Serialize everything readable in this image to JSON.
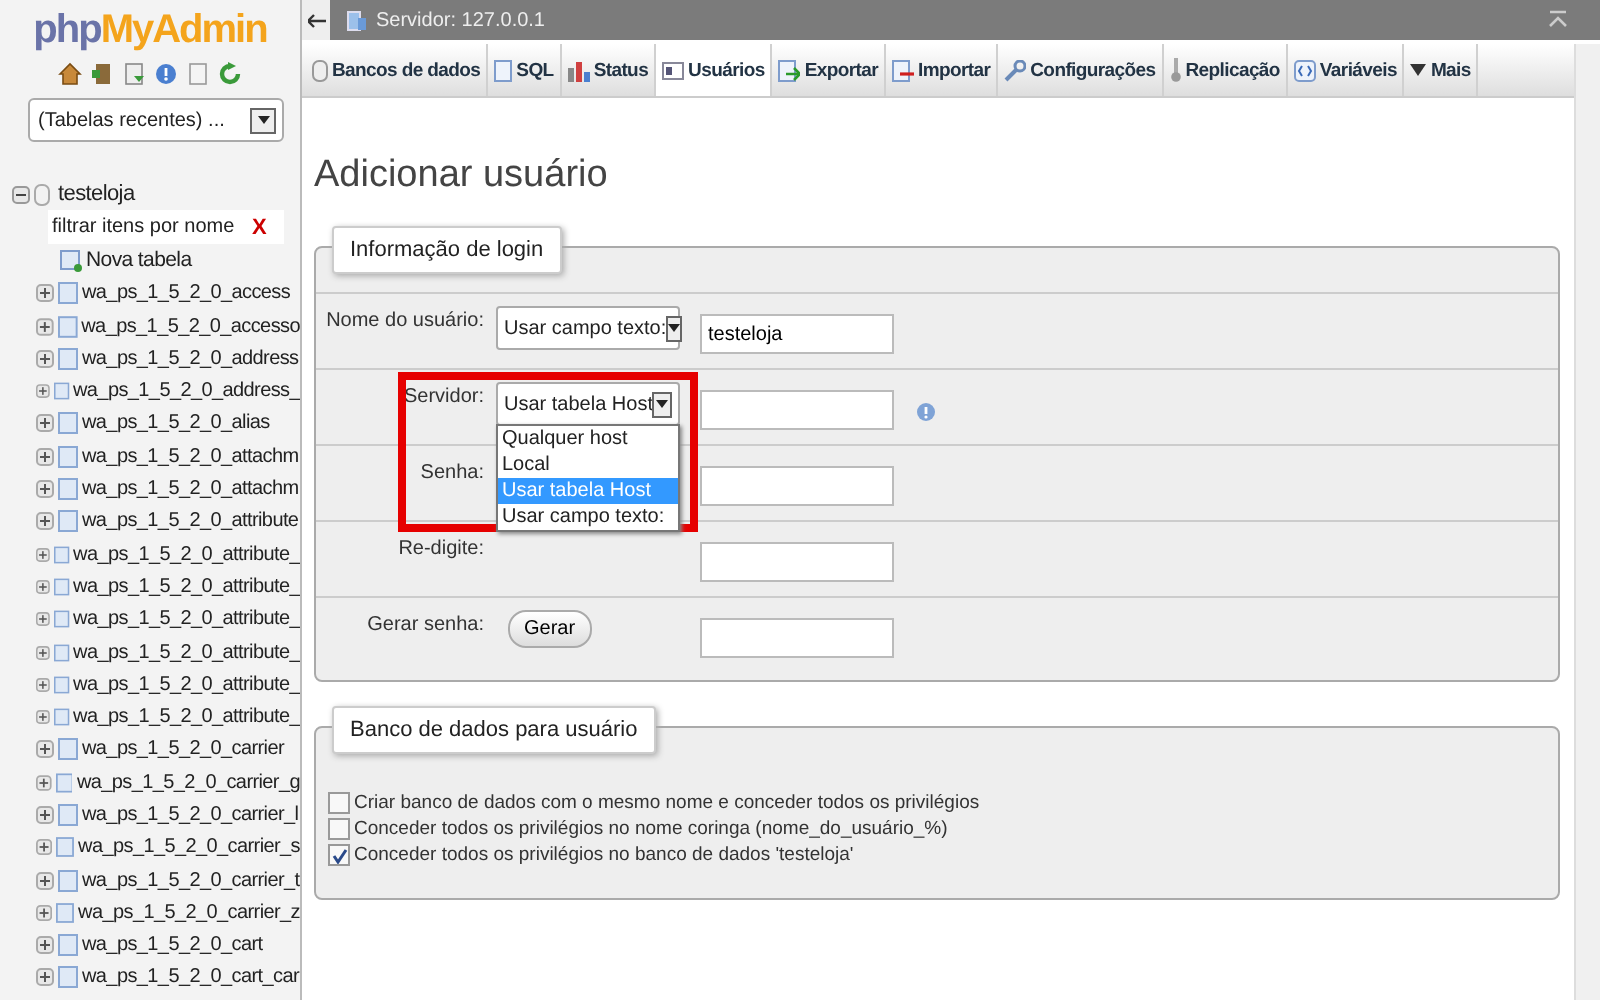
{
  "sidebar": {
    "logo": {
      "prefix": "php",
      "name": "MyAdmin"
    },
    "recent_select": {
      "value": "(Tabelas recentes) ..."
    },
    "tree": {
      "database": "testeloja",
      "expanded": true,
      "filter": {
        "placeholder": "filtrar itens por nome",
        "clear": "X"
      },
      "new_table": "Nova tabela",
      "tables": [
        "wa_ps_1_5_2_0_access",
        "wa_ps_1_5_2_0_accesso",
        "wa_ps_1_5_2_0_address",
        "wa_ps_1_5_2_0_address_",
        "wa_ps_1_5_2_0_alias",
        "wa_ps_1_5_2_0_attachm",
        "wa_ps_1_5_2_0_attachm",
        "wa_ps_1_5_2_0_attribute",
        "wa_ps_1_5_2_0_attribute_",
        "wa_ps_1_5_2_0_attribute_",
        "wa_ps_1_5_2_0_attribute_",
        "wa_ps_1_5_2_0_attribute_",
        "wa_ps_1_5_2_0_attribute_",
        "wa_ps_1_5_2_0_attribute_",
        "wa_ps_1_5_2_0_carrier",
        "wa_ps_1_5_2_0_carrier_g",
        "wa_ps_1_5_2_0_carrier_l",
        "wa_ps_1_5_2_0_carrier_s",
        "wa_ps_1_5_2_0_carrier_t",
        "wa_ps_1_5_2_0_carrier_z",
        "wa_ps_1_5_2_0_cart",
        "wa_ps_1_5_2_0_cart_car"
      ]
    }
  },
  "server_bar": {
    "title": "Servidor: 127.0.0.1"
  },
  "tabs": [
    {
      "label": "Bancos de dados",
      "selected": false
    },
    {
      "label": "SQL",
      "selected": false
    },
    {
      "label": "Status",
      "selected": false
    },
    {
      "label": "Usuários",
      "selected": true
    },
    {
      "label": "Exportar",
      "selected": false
    },
    {
      "label": "Importar",
      "selected": false
    },
    {
      "label": "Configurações",
      "selected": false
    },
    {
      "label": "Replicação",
      "selected": false
    },
    {
      "label": "Variáveis",
      "selected": false
    },
    {
      "label": "Mais",
      "selected": false
    }
  ],
  "heading": "Adicionar usuário",
  "login_info": {
    "legend": "Informação de login",
    "rows": [
      {
        "label": "Nome do usuário:",
        "select": "Usar campo texto:",
        "value": "testeloja"
      },
      {
        "label": "Servidor:",
        "select": "Usar tabela Host",
        "help": true,
        "highlighted": true,
        "dropdown": [
          {
            "label": "Qualquer host",
            "selected": false
          },
          {
            "label": "Local",
            "selected": false
          },
          {
            "label": "Usar tabela Host",
            "selected": true
          },
          {
            "label": "Usar campo texto:",
            "selected": false
          }
        ]
      },
      {
        "label": "Senha:"
      },
      {
        "label": "Re-digite:"
      },
      {
        "label": "Gerar senha:",
        "button": "Gerar"
      }
    ]
  },
  "database_for_user": {
    "legend": "Banco de dados para usuário",
    "options": [
      {
        "label": "Criar banco de dados com o mesmo nome e conceder todos os privilégios",
        "checked": false
      },
      {
        "label": "Conceder todos os privilégios no nome coringa (nome_do_usuário_%)",
        "checked": false
      },
      {
        "label": "Conceder todos os privilégios no banco de dados 'testeloja'",
        "checked": true
      }
    ]
  }
}
